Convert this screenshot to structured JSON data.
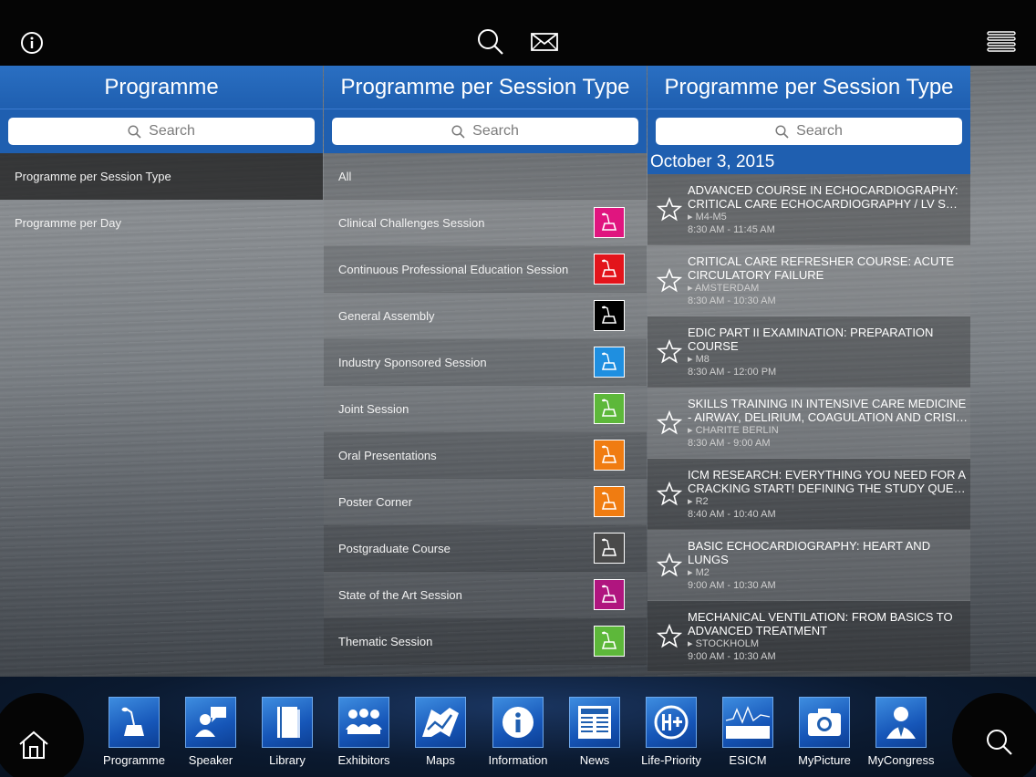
{
  "topbar": {
    "info_icon": "info-icon",
    "search_icon": "search-icon",
    "mail_icon": "mail-icon",
    "menu_icon": "hamburger-menu-icon"
  },
  "panel1": {
    "title": "Programme",
    "search_placeholder": "Search",
    "items": [
      {
        "label": "Programme per Session Type",
        "active": true
      },
      {
        "label": "Programme per Day",
        "active": false
      }
    ]
  },
  "panel2": {
    "title": "Programme per Session Type",
    "search_placeholder": "Search",
    "all_label": "All",
    "types": [
      {
        "label": "Clinical Challenges Session",
        "color": "#e0157f"
      },
      {
        "label": "Continuous Professional Education Session",
        "color": "#e3141b"
      },
      {
        "label": "General Assembly",
        "color": "#000000"
      },
      {
        "label": "Industry Sponsored Session",
        "color": "#1f8fe0"
      },
      {
        "label": "Joint Session",
        "color": "#5db83a"
      },
      {
        "label": "Oral Presentations",
        "color": "#f07c11"
      },
      {
        "label": "Poster Corner",
        "color": "#f07c11"
      },
      {
        "label": "Postgraduate Course",
        "color": "#4a4a4a"
      },
      {
        "label": "State of the Art Session",
        "color": "#b0157f"
      },
      {
        "label": "Thematic Session",
        "color": "#5db83a"
      }
    ]
  },
  "panel3": {
    "title": "Programme per Session Type",
    "search_placeholder": "Search",
    "date": "October 3, 2015",
    "sessions": [
      {
        "title": "ADVANCED COURSE IN ECHOCARDIOGRAPHY: CRITICAL CARE ECHOCARDIOGRAPHY / LV S…",
        "room": "▸ M4-M5",
        "time": "8:30 AM - 11:45 AM"
      },
      {
        "title": "CRITICAL CARE REFRESHER COURSE: ACUTE CIRCULATORY FAILURE",
        "room": "▸ AMSTERDAM",
        "time": "8:30 AM - 10:30 AM"
      },
      {
        "title": "EDIC PART II EXAMINATION: PREPARATION COURSE",
        "room": "▸ M8",
        "time": "8:30 AM - 12:00 PM"
      },
      {
        "title": "SKILLS TRAINING IN INTENSIVE CARE MEDICINE - AIRWAY, DELIRIUM, COAGULATION AND CRISI…",
        "room": "▸ CHARITE BERLIN",
        "time": "8:30 AM - 9:00 AM"
      },
      {
        "title": "ICM RESEARCH: EVERYTHING YOU NEED FOR A CRACKING START! DEFINING THE STUDY QUE…",
        "room": "▸ R2",
        "time": "8:40 AM - 10:40 AM"
      },
      {
        "title": "BASIC ECHOCARDIOGRAPHY: HEART AND LUNGS",
        "room": "▸ M2",
        "time": "9:00 AM - 10:30 AM"
      },
      {
        "title": "MECHANICAL VENTILATION: FROM BASICS TO ADVANCED TREATMENT",
        "room": "▸ STOCKHOLM",
        "time": "9:00 AM - 10:30 AM"
      }
    ]
  },
  "dock": {
    "items": [
      {
        "label": "Programme",
        "icon": "podium-icon"
      },
      {
        "label": "Speaker",
        "icon": "speaker-icon"
      },
      {
        "label": "Library",
        "icon": "book-icon"
      },
      {
        "label": "Exhibitors",
        "icon": "group-icon"
      },
      {
        "label": "Maps",
        "icon": "map-icon"
      },
      {
        "label": "Information",
        "icon": "info-icon"
      },
      {
        "label": "News",
        "icon": "newspaper-icon"
      },
      {
        "label": "Life-Priority",
        "icon": "life-priority-icon"
      },
      {
        "label": "ESICM",
        "icon": "esicm-logo-icon"
      },
      {
        "label": "MyPicture",
        "icon": "camera-icon"
      },
      {
        "label": "MyCongress",
        "icon": "person-icon"
      }
    ]
  }
}
